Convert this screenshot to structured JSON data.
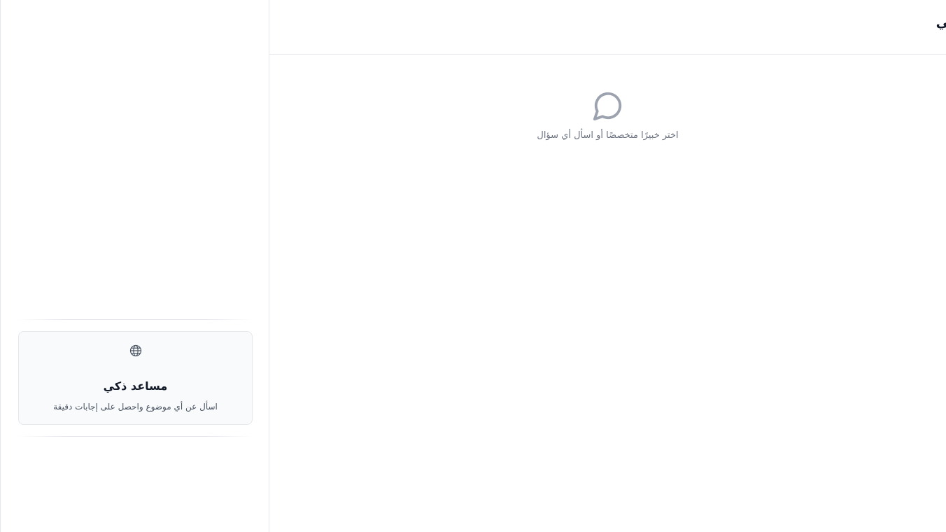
{
  "header": {
    "title": "بي"
  },
  "sidebar": {
    "assistant_card": {
      "icon": "globe-icon",
      "title": "مساعد ذكي",
      "description": "اسأل عن أي موضوع واحصل على إجابات دقيقة"
    }
  },
  "main": {
    "empty_state": {
      "icon": "chat-bubble-icon",
      "text": "اختر خبيرًا متخصصًا أو اسأل أي سؤال"
    }
  },
  "colors": {
    "border": "#e5e7eb",
    "card_background": "#f9fafb",
    "muted_text": "#6b7280",
    "icon_gray": "#9ca3af"
  }
}
